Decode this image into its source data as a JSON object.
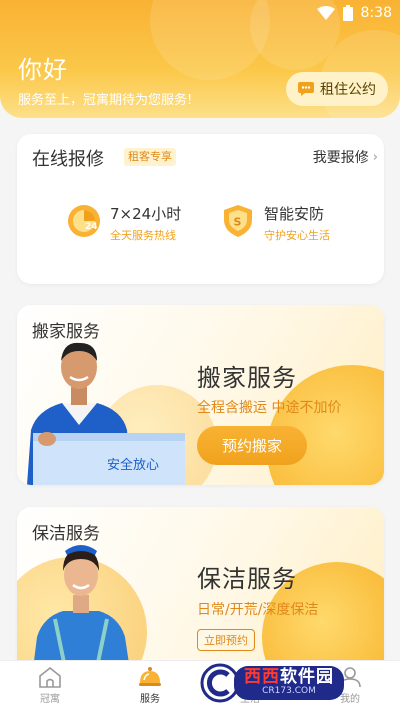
{
  "status_bar": {
    "time": "8:38"
  },
  "header": {
    "greeting": "你好",
    "subtitle": "服务至上，冠寓期待为您服务!",
    "agreement_button": "租住公约"
  },
  "repair": {
    "title": "在线报修",
    "badge": "租客专享",
    "link": "我要报修",
    "features": [
      {
        "title": "7×24小时",
        "subtitle": "全天服务热线",
        "icon": "clock-24-icon"
      },
      {
        "title": "智能安防",
        "subtitle": "守护安心生活",
        "icon": "shield-icon"
      }
    ]
  },
  "moving": {
    "label": "搬家服务",
    "title": "搬家服务",
    "desc": "全程含搬运 中途不加价",
    "button": "预约搬家",
    "box_text": "安全放心"
  },
  "cleaning": {
    "label": "保洁服务",
    "title": "保洁服务",
    "desc": "日常/开荒/深度保洁",
    "button": "立即预约"
  },
  "tabs": [
    {
      "label": "冠寓",
      "icon": "home-icon",
      "active": false
    },
    {
      "label": "服务",
      "icon": "service-bell-icon",
      "active": true
    },
    {
      "label": "生活",
      "icon": "life-icon",
      "active": false
    },
    {
      "label": "我的",
      "icon": "profile-icon",
      "active": false
    }
  ],
  "watermark": {
    "main_red": "西西",
    "main_white": "软件园",
    "sub": "CR173.COM"
  },
  "colors": {
    "accent": "#f9b233",
    "accent_dark": "#e0891a"
  }
}
